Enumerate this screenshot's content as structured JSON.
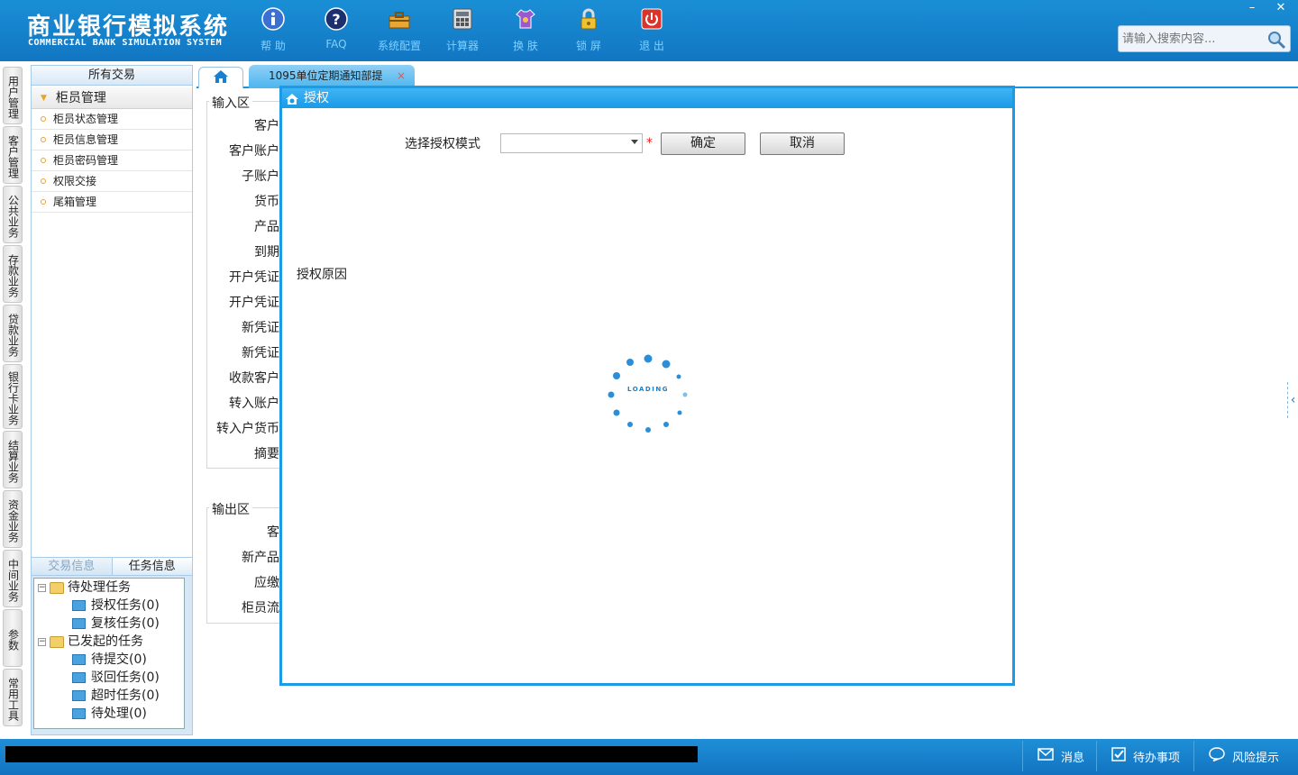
{
  "app": {
    "title_cn": "商业银行模拟系统",
    "title_en": "COMMERCIAL BANK SIMULATION SYSTEM"
  },
  "toolbar": {
    "items": [
      {
        "label": "帮 助",
        "icon": "info-icon"
      },
      {
        "label": "FAQ",
        "icon": "question-icon"
      },
      {
        "label": "系统配置",
        "icon": "toolbox-icon"
      },
      {
        "label": "计算器",
        "icon": "calculator-icon"
      },
      {
        "label": "换 肤",
        "icon": "shirt-icon"
      },
      {
        "label": "锁 屏",
        "icon": "lock-icon"
      },
      {
        "label": "退 出",
        "icon": "power-icon"
      }
    ],
    "label_color": "#7fd0ff"
  },
  "search": {
    "placeholder": "请输入搜索内容..."
  },
  "window_controls": {
    "minimize": "–",
    "close": "✕"
  },
  "vertical_tabs": [
    "用户管理",
    "客户管理",
    "公共业务",
    "存款业务",
    "贷款业务",
    "银行卡业务",
    "结算业务",
    "资金业务",
    "中间业务",
    "参数",
    "常用工具"
  ],
  "nav": {
    "header": "所有交易",
    "group": "柜员管理",
    "items": [
      "柜员状态管理",
      "柜员信息管理",
      "柜员密码管理",
      "权限交接",
      "尾箱管理"
    ]
  },
  "task_panel": {
    "tabs": [
      "交易信息",
      "任务信息"
    ],
    "tree": {
      "pending": "待处理任务",
      "pending_children": [
        "授权任务(0)",
        "复核任务(0)"
      ],
      "initiated": "已发起的任务",
      "initiated_children": [
        "待提交(0)",
        "驳回任务(0)",
        "超时任务(0)",
        "待处理(0)"
      ]
    }
  },
  "content_tab": {
    "label": "1095单位定期通知部提",
    "close": "×"
  },
  "form": {
    "input_legend": "输入区",
    "input_labels": [
      "客户",
      "客户账户",
      "子账户",
      "货币",
      "产品",
      "到期",
      "开户凭证",
      "开户凭证",
      "新凭证",
      "新凭证",
      "收款客户",
      "转入账户",
      "转入户货币",
      "摘要"
    ],
    "output_legend": "输出区",
    "output_labels": [
      "客",
      "新产品",
      "应缴",
      "柜员流"
    ]
  },
  "modal": {
    "title": "授权",
    "mode_label": "选择授权模式",
    "mode_value": "",
    "required_mark": "*",
    "confirm": "确定",
    "cancel": "取消",
    "reason_label": "授权原因",
    "loading_text": "LOADING"
  },
  "statusbar": {
    "items": [
      {
        "label": "消息",
        "icon": "mail-icon"
      },
      {
        "label": "待办事项",
        "icon": "checkbox-icon"
      },
      {
        "label": "风险提示",
        "icon": "chat-icon"
      }
    ]
  },
  "colors": {
    "brand_blue": "#1276c2",
    "accent": "#1b9ae6",
    "required": "#e02020"
  }
}
